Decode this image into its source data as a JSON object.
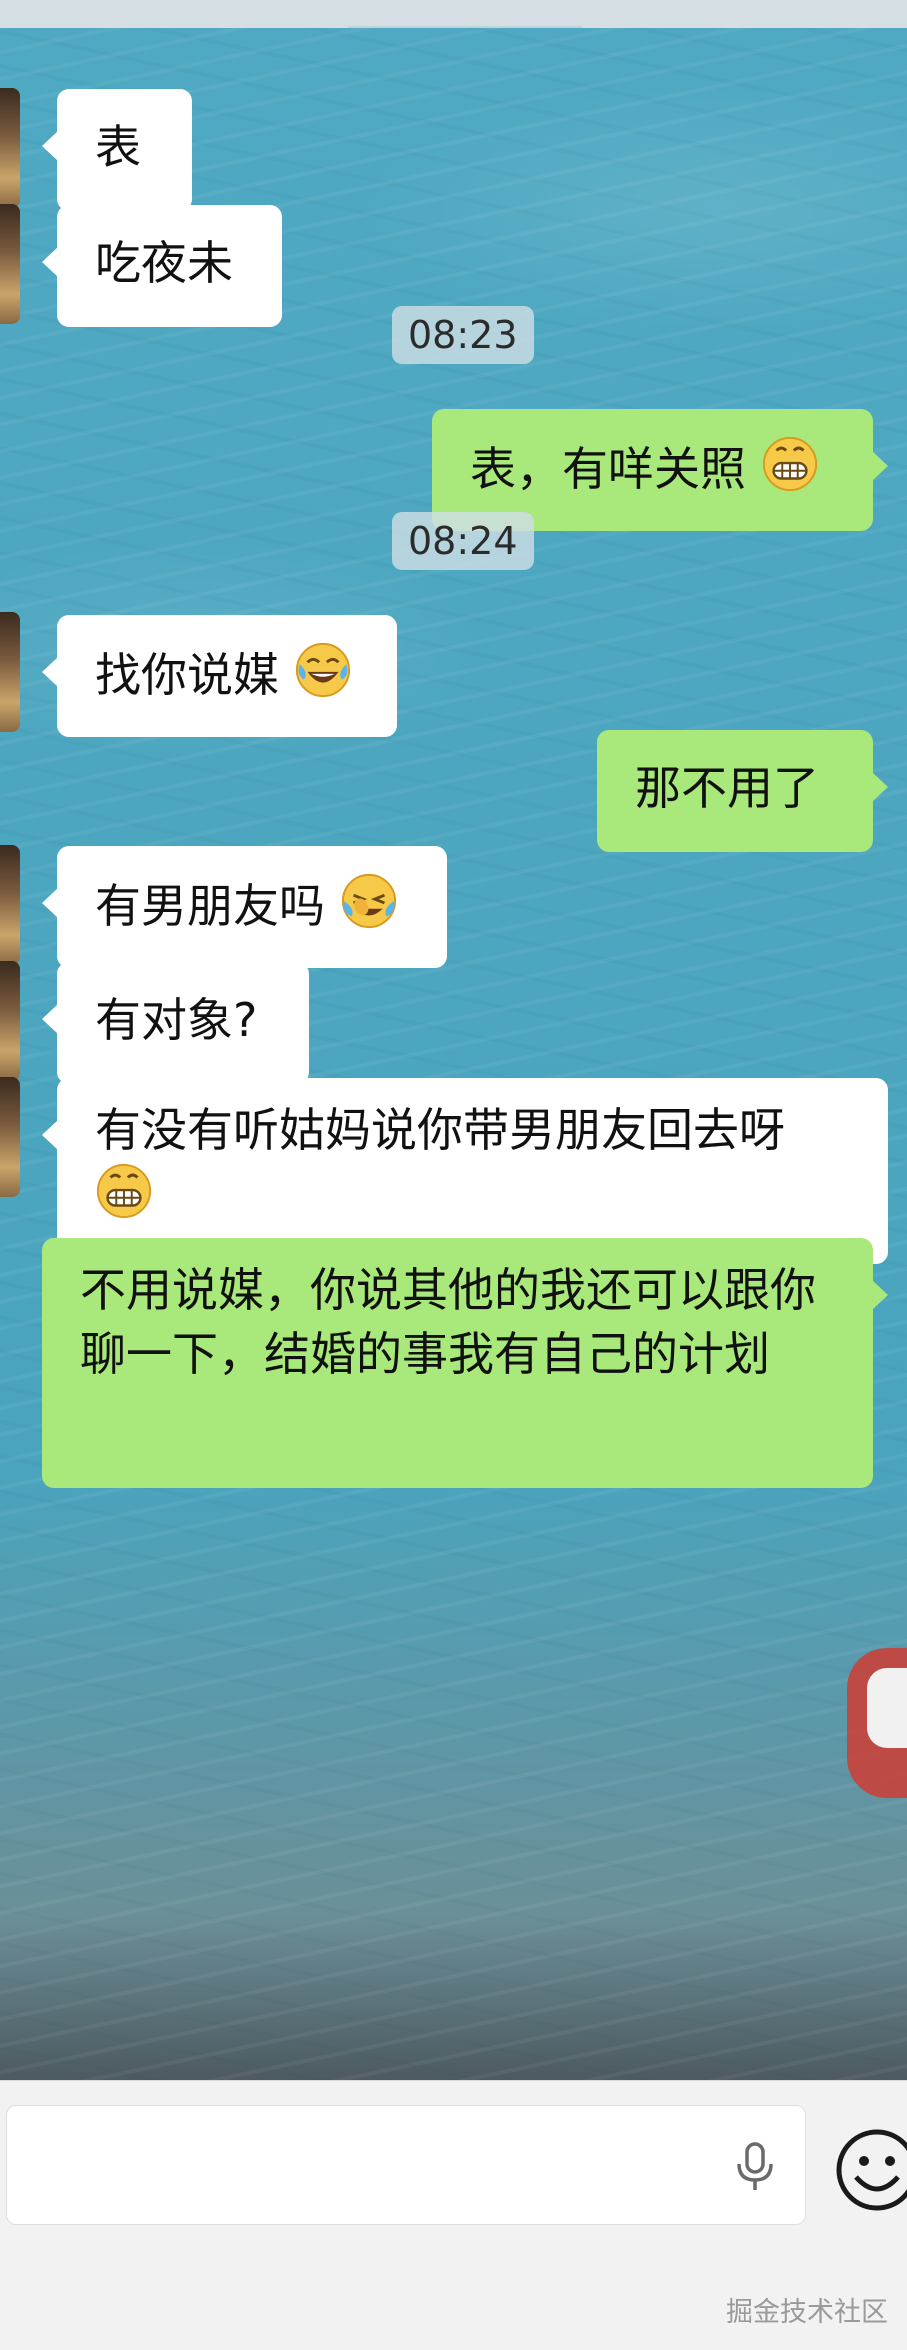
{
  "messages": [
    {
      "text": "表"
    },
    {
      "text": "吃夜未"
    },
    {
      "time": "08:23"
    },
    {
      "text": "表，有咩关照",
      "emoji": "grinning-face"
    },
    {
      "time": "08:24"
    },
    {
      "text": "找你说媒",
      "emoji": "tears-of-joy"
    },
    {
      "text": "那不用了"
    },
    {
      "text": "有男朋友吗",
      "emoji": "crying-laughing"
    },
    {
      "text": "有对象?"
    },
    {
      "text": "有没有听姑妈说你带男朋友回去呀",
      "emoji": "grinning-face"
    },
    {
      "text": "不用说媒，你说其他的我还可以跟你聊一下，结婚的事我有自己的计划"
    }
  ],
  "input": {
    "value": "",
    "mic_icon": "mic-icon",
    "emoji_icon": "smile-icon"
  },
  "watermark": "掘金技术社区",
  "colors": {
    "incoming": "#ffffff",
    "outgoing": "#a9e87a",
    "chat_bg": "#4aa4be"
  }
}
